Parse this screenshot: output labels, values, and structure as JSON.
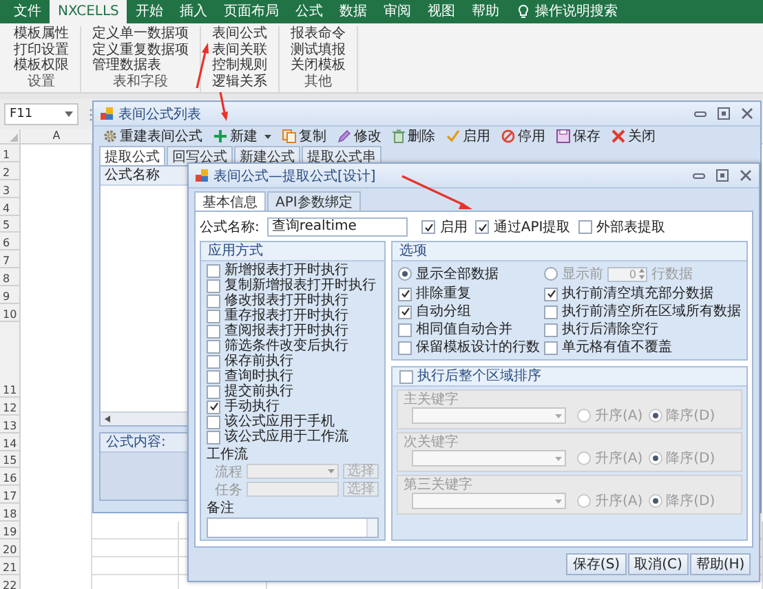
{
  "ribbon": {
    "tabs": [
      {
        "label": "文件",
        "selected": false
      },
      {
        "label": "NXCELLS",
        "selected": true
      },
      {
        "label": "开始",
        "selected": false
      },
      {
        "label": "插入",
        "selected": false
      },
      {
        "label": "页面布局",
        "selected": false
      },
      {
        "label": "公式",
        "selected": false
      },
      {
        "label": "数据",
        "selected": false
      },
      {
        "label": "审阅",
        "selected": false
      },
      {
        "label": "视图",
        "selected": false
      },
      {
        "label": "帮助",
        "selected": false
      }
    ],
    "search": "操作说明搜索",
    "groups": [
      {
        "items": [
          "模板属性",
          "打印设置",
          "模板权限"
        ],
        "label": "设置"
      },
      {
        "items": [
          "定义单一数据项",
          "定义重复数据项",
          "管理数据表"
        ],
        "label": "表和字段"
      },
      {
        "items": [
          "表间公式",
          "表间关联",
          "控制规则",
          "逻辑关系"
        ]
      },
      {
        "items": [
          "报表命令",
          "测试填报",
          "关闭模板"
        ],
        "label": "其他"
      }
    ]
  },
  "name_box": "F11",
  "sheet": {
    "column": "A",
    "rows": [
      "1",
      "2",
      "3",
      "4",
      "5",
      "6",
      "7",
      "8",
      "9",
      "10",
      "11",
      "12",
      "13",
      "14",
      "15",
      "16",
      "17",
      "18",
      "19",
      "20",
      "21",
      "22"
    ]
  },
  "list_window": {
    "title": "表间公式列表",
    "toolbar": [
      {
        "kind": "rebuild",
        "label": "重建表间公式",
        "dropdown": false
      },
      {
        "kind": "new",
        "label": "新建",
        "dropdown": true
      },
      {
        "kind": "copy",
        "label": "复制",
        "dropdown": false
      },
      {
        "kind": "edit",
        "label": "修改",
        "dropdown": false
      },
      {
        "kind": "delete",
        "label": "删除",
        "dropdown": false
      },
      {
        "kind": "enable",
        "label": "启用",
        "dropdown": false
      },
      {
        "kind": "disable",
        "label": "停用",
        "dropdown": false
      },
      {
        "kind": "save",
        "label": "保存",
        "dropdown": false
      },
      {
        "kind": "close",
        "label": "关闭",
        "dropdown": false
      }
    ],
    "tabs": [
      {
        "label": "提取公式",
        "selected": true
      },
      {
        "label": "回写公式",
        "selected": false
      },
      {
        "label": "新建公式",
        "selected": false
      },
      {
        "label": "提取公式串",
        "selected": false
      }
    ],
    "list_header": "公式名称",
    "content_label": "公式内容:"
  },
  "design_window": {
    "title": "表间公式—提取公式[设计]",
    "tabs": [
      {
        "label": "基本信息",
        "selected": true
      },
      {
        "label": "API参数绑定",
        "selected": false
      }
    ],
    "name_label": "公式名称:",
    "name_value": "查询realtime",
    "flags": [
      {
        "label": "启用",
        "checked": true
      },
      {
        "label": "通过API提取",
        "checked": true
      },
      {
        "label": "外部表提取",
        "checked": false
      }
    ],
    "apply": {
      "title": "应用方式",
      "options": [
        {
          "label": "新增报表打开时执行",
          "checked": false
        },
        {
          "label": "复制新增报表打开时执行",
          "checked": false
        },
        {
          "label": "修改报表打开时执行",
          "checked": false
        },
        {
          "label": "重存报表打开时执行",
          "checked": false
        },
        {
          "label": "查阅报表打开时执行",
          "checked": false
        },
        {
          "label": "筛选条件改变后执行",
          "checked": false
        },
        {
          "label": "保存前执行",
          "checked": false
        },
        {
          "label": "查询时执行",
          "checked": false
        },
        {
          "label": "提交前执行",
          "checked": false
        },
        {
          "label": "手动执行",
          "checked": true
        },
        {
          "label": "该公式应用于手机",
          "checked": false
        },
        {
          "label": "该公式应用于工作流",
          "checked": false
        }
      ]
    },
    "workflow": {
      "title": "工作流",
      "disabled": true,
      "fields": [
        {
          "label": "流程",
          "kind": "select",
          "button": "选择"
        },
        {
          "label": "任务",
          "kind": "text",
          "button": "选择"
        }
      ]
    },
    "remark_label": "备注",
    "options": {
      "title": "选项",
      "display": [
        {
          "label": "显示全部数据",
          "selected": true
        },
        {
          "label": "显示前",
          "selected": false
        }
      ],
      "count": "0",
      "count_suffix": "行数据",
      "checks": [
        {
          "label": "排除重复",
          "checked": true
        },
        {
          "label": "执行前清空填充部分数据",
          "checked": true
        },
        {
          "label": "自动分组",
          "checked": true
        },
        {
          "label": "执行前清空所在区域所有数据",
          "checked": false
        },
        {
          "label": "相同值自动合并",
          "checked": false
        },
        {
          "label": "执行后清除空行",
          "checked": false
        },
        {
          "label": "保留模板设计的行数",
          "checked": false
        },
        {
          "label": "单元格有值不覆盖",
          "checked": false
        }
      ]
    },
    "sort": {
      "label": "执行后整个区域排序",
      "checked": false,
      "keys": [
        {
          "label": "主关键字",
          "orders": [
            {
              "label": "升序(A)",
              "selected": false
            },
            {
              "label": "降序(D)",
              "selected": true
            }
          ]
        },
        {
          "label": "次关键字",
          "orders": [
            {
              "label": "升序(A)",
              "selected": false
            },
            {
              "label": "降序(D)",
              "selected": true
            }
          ]
        },
        {
          "label": "第三关键字",
          "orders": [
            {
              "label": "升序(A)",
              "selected": false
            },
            {
              "label": "降序(D)",
              "selected": true
            }
          ]
        }
      ]
    },
    "buttons": [
      "保存(S)",
      "取消(C)",
      "帮助(H)"
    ]
  }
}
